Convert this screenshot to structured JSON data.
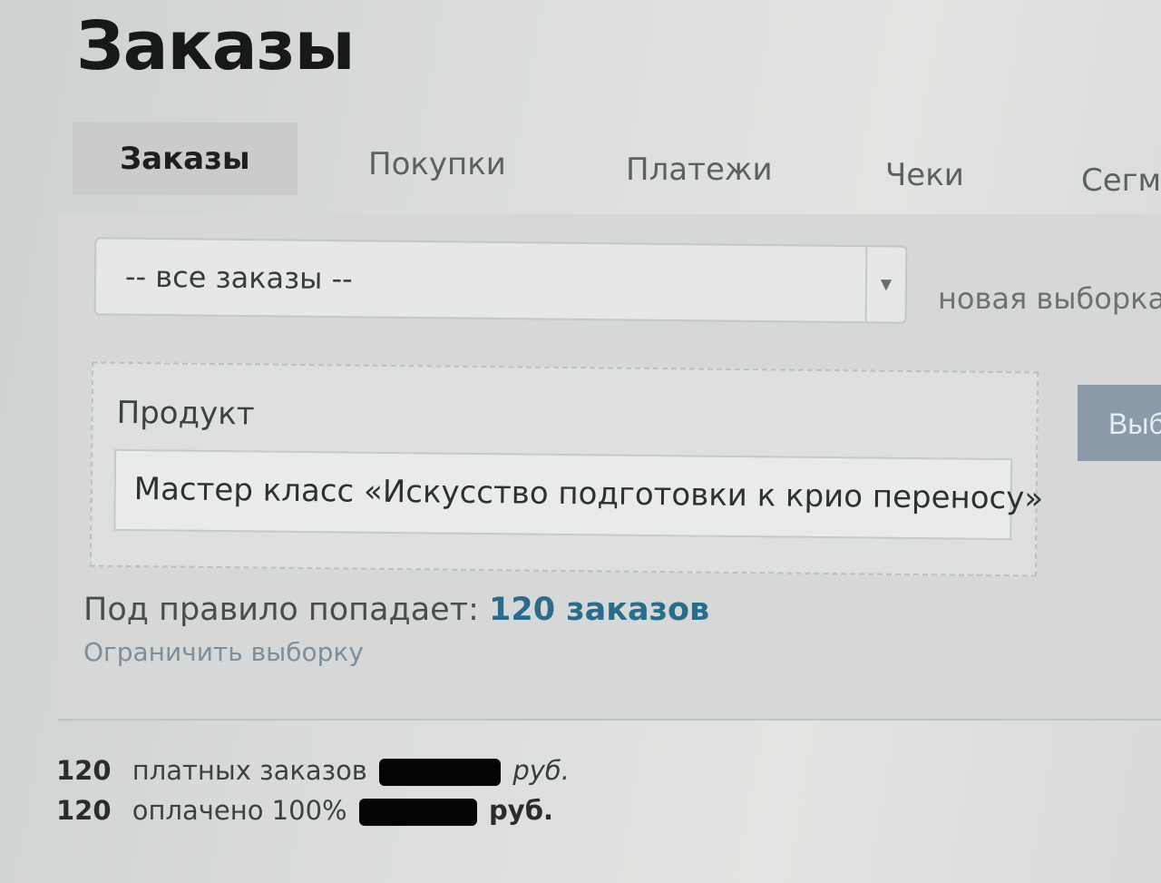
{
  "page": {
    "title": "Заказы"
  },
  "tabs": [
    {
      "label": "Заказы",
      "active": true
    },
    {
      "label": "Покупки",
      "active": false
    },
    {
      "label": "Платежи",
      "active": false
    },
    {
      "label": "Чеки",
      "active": false
    },
    {
      "label": "Сегм",
      "active": false
    }
  ],
  "filter": {
    "selected_value": "-- все заказы --",
    "arrow_icon": "dropdown-arrow-icon",
    "new_selection_label": "новая выборка"
  },
  "rule": {
    "label": "Продукт",
    "product_value": "Мастер класс «Искусство подготовки к крио переносу»"
  },
  "apply_button": {
    "label": "Выб"
  },
  "rule_result": {
    "prefix": "Под правило попадает:",
    "count_text": "120 заказов"
  },
  "limit_link": {
    "label": "Ограничить выборку"
  },
  "summary": [
    {
      "count": "120",
      "label": "платных заказов",
      "currency": "руб."
    },
    {
      "count": "120",
      "label": "оплачено 100%",
      "currency": "руб."
    }
  ],
  "colors": {
    "accent_link": "#2a6c8c",
    "button_bg": "#8b9aa8",
    "redaction": "#050505"
  }
}
